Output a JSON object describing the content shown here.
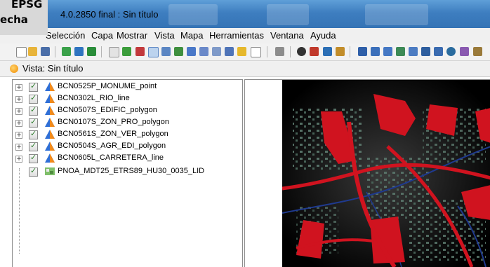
{
  "window": {
    "title": "4.0.2850 final : Sin título"
  },
  "overlay": {
    "line1": "EPSG",
    "line2": "echa"
  },
  "menu": [
    "Selección",
    "Capa",
    "Mostrar",
    "Vista",
    "Mapa",
    "Herramientas",
    "Ventana",
    "Ayuda"
  ],
  "view": {
    "title": "Vista: Sin título"
  },
  "layers": [
    {
      "name": "BCN0525P_MONUME_point",
      "checked": true
    },
    {
      "name": "BCN0302L_RIO_line",
      "checked": true
    },
    {
      "name": "BCN0507S_EDIFIC_polygon",
      "checked": true
    },
    {
      "name": "BCN0107S_ZON_PRO_polygon",
      "checked": true
    },
    {
      "name": "BCN0561S_ZON_VER_polygon",
      "checked": true
    },
    {
      "name": "BCN0504S_AGR_EDI_polygon",
      "checked": true
    },
    {
      "name": "BCN0605L_CARRETERA_line",
      "checked": true
    },
    {
      "name": "PNOA_MDT25_ETRS89_HU30_0035_LID",
      "checked": true
    }
  ],
  "colors": {
    "title_bar": "#3e7ec0",
    "polygon_fill": "#d0131f",
    "river": "#1f3a8f",
    "map_bg": "#000000"
  },
  "icons": [
    "new-icon",
    "open-icon",
    "save-icon",
    "pan-icon",
    "zoom-in-icon",
    "zoom-out-icon",
    "info-icon",
    "select-icon"
  ]
}
